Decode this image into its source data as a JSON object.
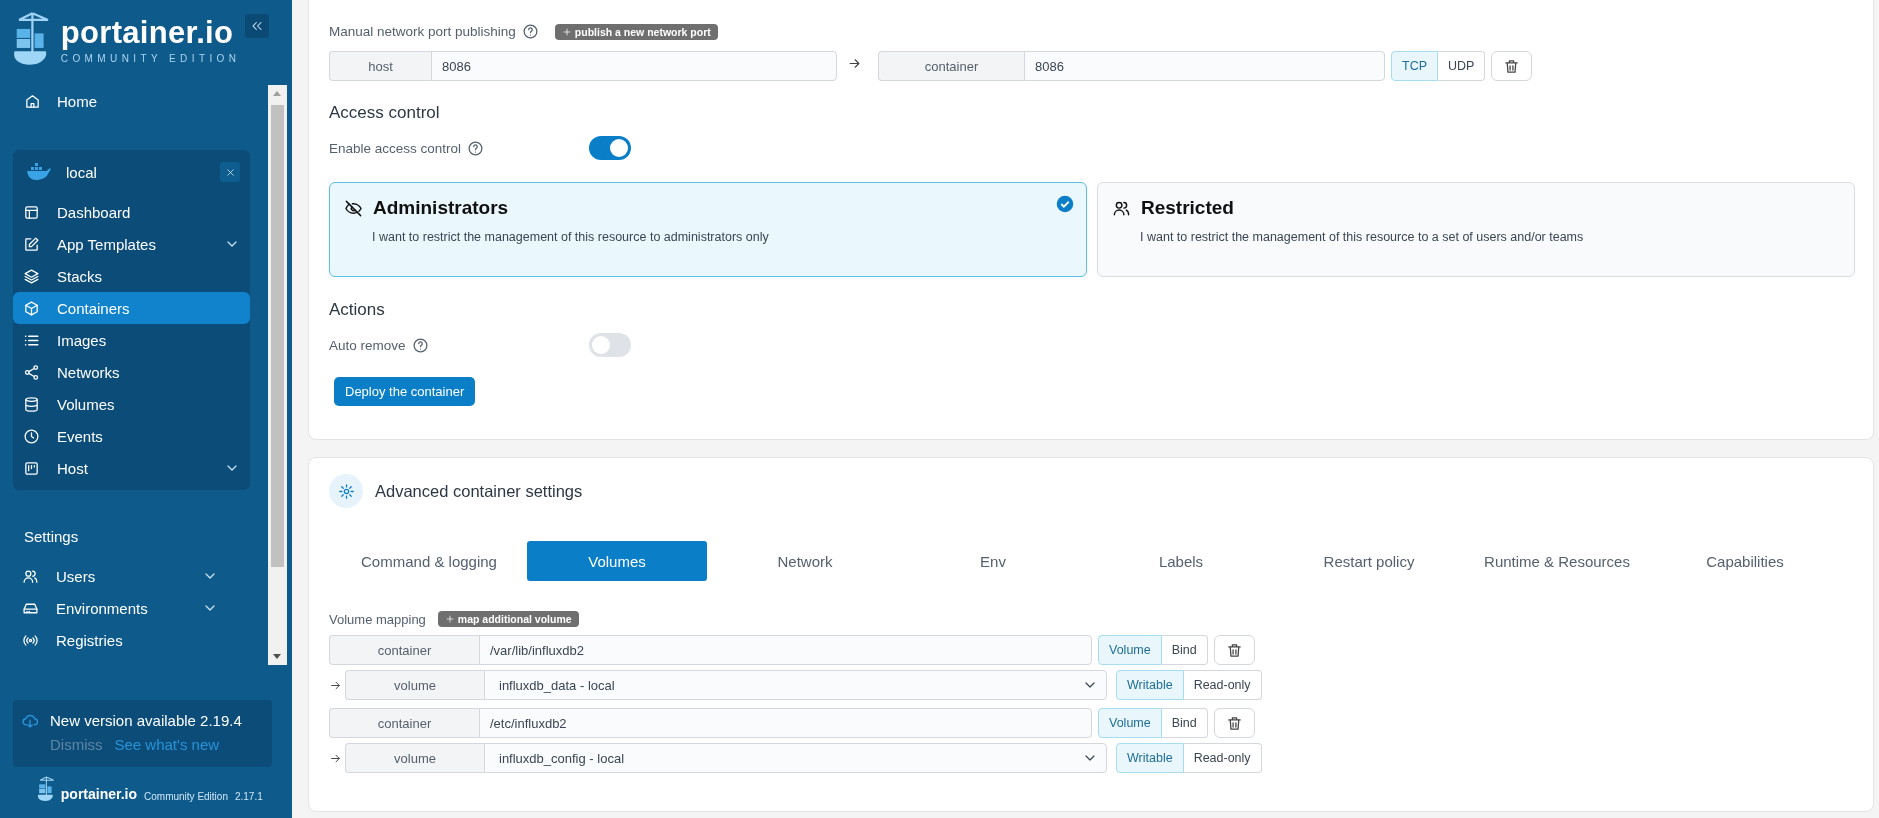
{
  "sidebar": {
    "logo": {
      "name": "portainer.io",
      "edition": "COMMUNITY EDITION"
    },
    "home": {
      "label": "Home"
    },
    "environment": {
      "name": "local",
      "items": [
        {
          "label": "Dashboard",
          "kind": "dashboard",
          "selected": false,
          "expandable": false
        },
        {
          "label": "App Templates",
          "kind": "templates",
          "selected": false,
          "expandable": true
        },
        {
          "label": "Stacks",
          "kind": "stacks",
          "selected": false,
          "expandable": false
        },
        {
          "label": "Containers",
          "kind": "containers",
          "selected": true,
          "expandable": false
        },
        {
          "label": "Images",
          "kind": "images",
          "selected": false,
          "expandable": false
        },
        {
          "label": "Networks",
          "kind": "networks",
          "selected": false,
          "expandable": false
        },
        {
          "label": "Volumes",
          "kind": "volumes",
          "selected": false,
          "expandable": false
        },
        {
          "label": "Events",
          "kind": "events",
          "selected": false,
          "expandable": false
        },
        {
          "label": "Host",
          "kind": "host",
          "selected": false,
          "expandable": true
        }
      ]
    },
    "settings": {
      "heading": "Settings",
      "items": [
        {
          "label": "Users",
          "kind": "users",
          "selected": false,
          "expandable": true
        },
        {
          "label": "Environments",
          "kind": "environments",
          "selected": false,
          "expandable": true
        },
        {
          "label": "Registries",
          "kind": "registries",
          "selected": false,
          "expandable": false
        }
      ]
    },
    "update_notice": {
      "title": "New version available 2.19.4",
      "dismiss": "Dismiss",
      "link": "See what's new"
    },
    "footer": {
      "brand": "portainer.io",
      "edition": "Community Edition",
      "version": "2.17.1"
    }
  },
  "port_publishing": {
    "label": "Manual network port publishing",
    "add_button": "publish a new network port",
    "ports": [
      {
        "host_label": "host",
        "host_value": "8086",
        "container_label": "container",
        "container_value": "8086",
        "protocols": [
          {
            "label": "TCP",
            "selected": true
          },
          {
            "label": "UDP",
            "selected": false
          }
        ]
      }
    ]
  },
  "access_control": {
    "heading": "Access control",
    "enable_label": "Enable access control",
    "enabled": true,
    "options": [
      {
        "kind": "administrators",
        "title": "Administrators",
        "description": "I want to restrict the management of this resource to administrators only",
        "selected": true
      },
      {
        "kind": "restricted",
        "title": "Restricted",
        "description": "I want to restrict the management of this resource to a set of users and/or teams",
        "selected": false
      }
    ]
  },
  "actions": {
    "heading": "Actions",
    "auto_remove_label": "Auto remove",
    "auto_remove": false,
    "deploy_button": "Deploy the container"
  },
  "advanced": {
    "title": "Advanced container settings",
    "tabs": [
      {
        "label": "Command & logging",
        "selected": false
      },
      {
        "label": "Volumes",
        "selected": true
      },
      {
        "label": "Network",
        "selected": false
      },
      {
        "label": "Env",
        "selected": false
      },
      {
        "label": "Labels",
        "selected": false
      },
      {
        "label": "Restart policy",
        "selected": false
      },
      {
        "label": "Runtime & Resources",
        "selected": false
      },
      {
        "label": "Capabilities",
        "selected": false
      }
    ],
    "volume_mapping": {
      "label": "Volume mapping",
      "add_button": "map additional volume",
      "mappings": [
        {
          "container_label": "container",
          "container_path": "/var/lib/influxdb2",
          "types": [
            {
              "label": "Volume",
              "selected": true
            },
            {
              "label": "Bind",
              "selected": false
            }
          ],
          "volume_label": "volume",
          "volume_value": "influxdb_data - local",
          "access": [
            {
              "label": "Writable",
              "selected": true
            },
            {
              "label": "Read-only",
              "selected": false
            }
          ]
        },
        {
          "container_label": "container",
          "container_path": "/etc/influxdb2",
          "types": [
            {
              "label": "Volume",
              "selected": true
            },
            {
              "label": "Bind",
              "selected": false
            }
          ],
          "volume_label": "volume",
          "volume_value": "influxdb_config - local",
          "access": [
            {
              "label": "Writable",
              "selected": true
            },
            {
              "label": "Read-only",
              "selected": false
            }
          ]
        }
      ]
    }
  }
}
